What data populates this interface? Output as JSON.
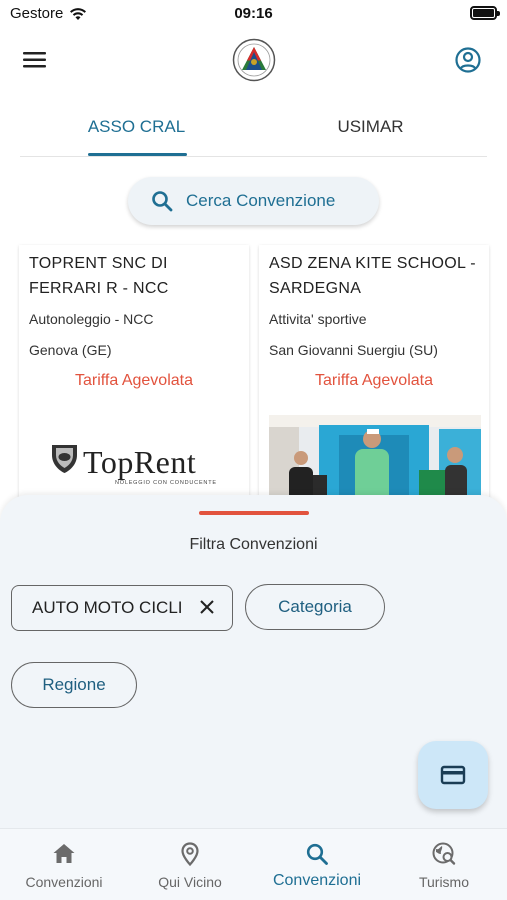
{
  "status_bar": {
    "carrier": "Gestore",
    "time": "09:16"
  },
  "header": {
    "menu_icon": "menu-icon",
    "logo_icon": "asso-cral-logo",
    "account_icon": "account-circle-icon"
  },
  "tabs": [
    {
      "label": "ASSO CRAL",
      "active": true
    },
    {
      "label": "USIMAR",
      "active": false
    }
  ],
  "search": {
    "label": "Cerca Convenzione",
    "icon": "search-icon"
  },
  "cards": [
    {
      "title": "TOPRENT SNC DI FERRARI R  - NCC",
      "category": "Autonoleggio - NCC",
      "location": "Genova (GE)",
      "rate": "Tariffa Agevolata",
      "logo_text": "TopRent",
      "logo_subtext": "NOLEGGIO CON CONDUCENTE"
    },
    {
      "title": "ASD ZENA KITE SCHOOL - SARDEGNA",
      "category": "Attivita' sportive",
      "location": "San Giovanni Suergiu (SU)",
      "rate": "Tariffa Agevolata"
    }
  ],
  "filter_sheet": {
    "title": "Filtra Convenzioni",
    "active_filter": "AUTO MOTO CICLI",
    "category_button": "Categoria",
    "region_button": "Regione"
  },
  "fab": {
    "icon": "card-icon"
  },
  "bottom_nav": [
    {
      "label": "Convenzioni",
      "icon": "home-icon",
      "active": false
    },
    {
      "label": "Qui Vicino",
      "icon": "location-pin-icon",
      "active": false
    },
    {
      "label": "Convenzioni",
      "icon": "search-icon",
      "active": true
    },
    {
      "label": "Turismo",
      "icon": "travel-explore-icon",
      "active": false
    }
  ],
  "colors": {
    "primary": "#1f6f93",
    "accent_red": "#e2533e",
    "sheet_bg": "#f1f5f9",
    "fab_bg": "#cde7f8"
  }
}
